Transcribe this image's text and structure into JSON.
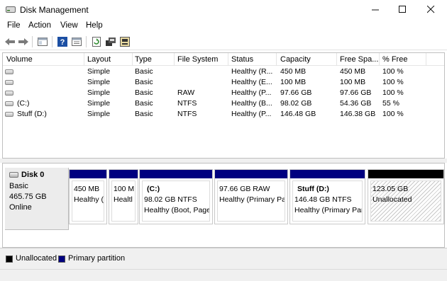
{
  "window": {
    "title": "Disk Management",
    "minimize": "—",
    "maximize": "☐",
    "close": "✕"
  },
  "menu": [
    "File",
    "Action",
    "View",
    "Help"
  ],
  "toolbar": {
    "icons": [
      "back-arrow-icon",
      "forward-arrow-icon",
      "console-tree-icon",
      "help-icon",
      "properties-icon",
      "refresh-icon",
      "rescan-disks-icon",
      "disk-properties-icon"
    ]
  },
  "volumes_table": {
    "columns": [
      "Volume",
      "Layout",
      "Type",
      "File System",
      "Status",
      "Capacity",
      "Free Spa...",
      "% Free"
    ],
    "rows": [
      [
        "",
        "Simple",
        "Basic",
        "",
        "Healthy (R...",
        "450 MB",
        "450 MB",
        "100 %"
      ],
      [
        "",
        "Simple",
        "Basic",
        "",
        "Healthy (E...",
        "100 MB",
        "100 MB",
        "100 %"
      ],
      [
        "",
        "Simple",
        "Basic",
        "RAW",
        "Healthy (P...",
        "97.66 GB",
        "97.66 GB",
        "100 %"
      ],
      [
        "(C:)",
        "Simple",
        "Basic",
        "NTFS",
        "Healthy (B...",
        "98.02 GB",
        "54.36 GB",
        "55 %"
      ],
      [
        "Stuff (D:)",
        "Simple",
        "Basic",
        "NTFS",
        "Healthy (P...",
        "146.48 GB",
        "146.38 GB",
        "100 %"
      ]
    ]
  },
  "disk": {
    "name": "Disk 0",
    "type": "Basic",
    "size": "465.75 GB",
    "state": "Online"
  },
  "partitions": [
    {
      "name": "",
      "size": "450 MB",
      "status": "Healthy (",
      "unallocated": false
    },
    {
      "name": "",
      "size": "100 M",
      "status": "Healtl",
      "unallocated": false
    },
    {
      "name": "(C:)",
      "size": "98.02 GB NTFS",
      "status": "Healthy (Boot, Page",
      "unallocated": false
    },
    {
      "name": "",
      "size": "97.66 GB RAW",
      "status": "Healthy (Primary Pa",
      "unallocated": false
    },
    {
      "name": "Stuff  (D:)",
      "size": "146.48 GB NTFS",
      "status": "Healthy (Primary Par",
      "unallocated": false
    },
    {
      "name": "",
      "size": "123.05 GB",
      "status": "Unallocated",
      "unallocated": true
    }
  ],
  "legend": [
    {
      "label": "Unallocated",
      "color": "#000000"
    },
    {
      "label": "Primary partition",
      "color": "#000080"
    }
  ],
  "colors": {
    "primary_partition": "#000080",
    "unallocated": "#000000"
  }
}
